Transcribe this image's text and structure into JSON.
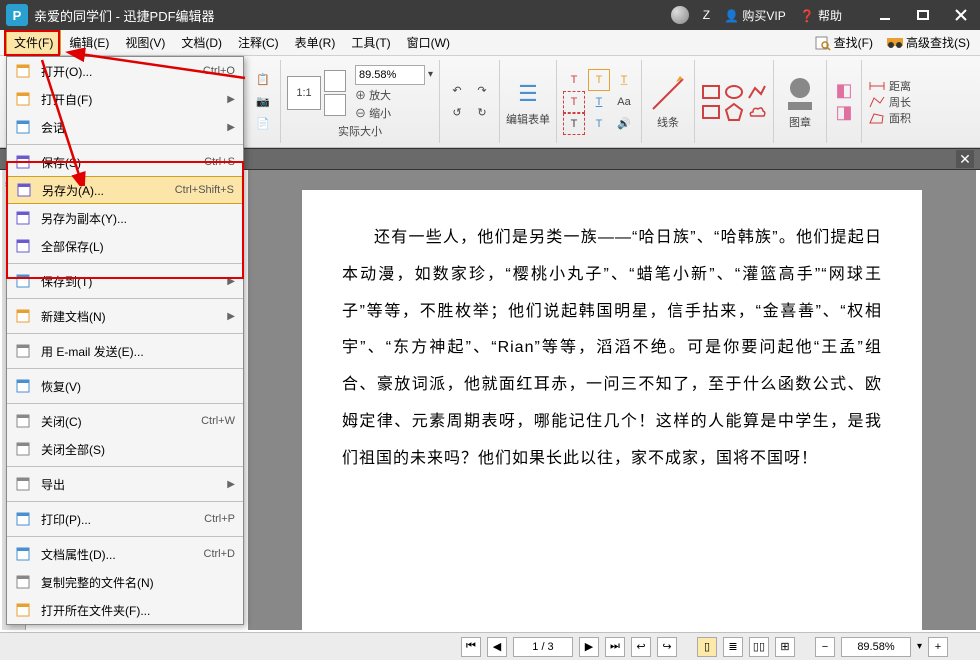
{
  "titlebar": {
    "app_icon_letter": "P",
    "title": "亲爱的同学们 - 迅捷PDF编辑器",
    "user_letter": "Z",
    "buy_vip": "购买VIP",
    "help": "帮助"
  },
  "menubar": {
    "items": [
      "文件(F)",
      "编辑(E)",
      "视图(V)",
      "文档(D)",
      "注释(C)",
      "表单(R)",
      "工具(T)",
      "窗口(W)"
    ],
    "find": "查找(F)",
    "advfind": "高级查找(S)"
  },
  "ribbon": {
    "real_size": "实际大小",
    "zoom_value": "89.58%",
    "zoom_in": "放大",
    "zoom_out": "缩小",
    "edit_form": "编辑表单",
    "lines": "线条",
    "stamp": "图章",
    "distance": "距离",
    "perimeter": "周长",
    "area": "面积"
  },
  "filemenu": {
    "items": [
      {
        "label": "打开(O)...",
        "shortcut": "Ctrl+O",
        "arrow": false,
        "sep": false,
        "color": "#e8a030"
      },
      {
        "label": "打开自(F)",
        "shortcut": "",
        "arrow": true,
        "sep": false,
        "color": "#e8a030"
      },
      {
        "label": "会话",
        "shortcut": "",
        "arrow": true,
        "sep": true,
        "color": "#4a90d0"
      },
      {
        "label": "保存(S)",
        "shortcut": "Ctrl+S",
        "arrow": false,
        "sep": false,
        "color": "#6a5acd"
      },
      {
        "label": "另存为(A)...",
        "shortcut": "Ctrl+Shift+S",
        "arrow": false,
        "sep": false,
        "selected": true,
        "color": "#6a5acd"
      },
      {
        "label": "另存为副本(Y)...",
        "shortcut": "",
        "arrow": false,
        "sep": false,
        "color": "#6a5acd"
      },
      {
        "label": "全部保存(L)",
        "shortcut": "",
        "arrow": false,
        "sep": true,
        "color": "#6a5acd"
      },
      {
        "label": "保存到(T)",
        "shortcut": "",
        "arrow": true,
        "sep": true,
        "color": "#4a90d0"
      },
      {
        "label": "新建文档(N)",
        "shortcut": "",
        "arrow": true,
        "sep": true,
        "color": "#e8a030"
      },
      {
        "label": "用 E-mail 发送(E)...",
        "shortcut": "",
        "arrow": false,
        "sep": true,
        "color": "#888"
      },
      {
        "label": "恢复(V)",
        "shortcut": "",
        "arrow": false,
        "sep": true,
        "color": "#4a90d0"
      },
      {
        "label": "关闭(C)",
        "shortcut": "Ctrl+W",
        "arrow": false,
        "sep": false,
        "color": "#888"
      },
      {
        "label": "关闭全部(S)",
        "shortcut": "",
        "arrow": false,
        "sep": true,
        "color": "#888"
      },
      {
        "label": "导出",
        "shortcut": "",
        "arrow": true,
        "sep": true,
        "color": "#888"
      },
      {
        "label": "打印(P)...",
        "shortcut": "Ctrl+P",
        "arrow": false,
        "sep": true,
        "color": "#4a90d0"
      },
      {
        "label": "文档属性(D)...",
        "shortcut": "Ctrl+D",
        "arrow": false,
        "sep": false,
        "color": "#4a90d0"
      },
      {
        "label": "复制完整的文件名(N)",
        "shortcut": "",
        "arrow": false,
        "sep": false,
        "color": "#888"
      },
      {
        "label": "打开所在文件夹(F)...",
        "shortcut": "",
        "arrow": false,
        "sep": false,
        "color": "#e8a030"
      }
    ]
  },
  "document": {
    "body": "还有一些人，他们是另类一族——“哈日族”、“哈韩族”。他们提起日本动漫，如数家珍，“樱桃小丸子”、“蜡笔小新”、“灌篮高手”“网球王子”等等，不胜枚举；他们说起韩国明星，信手拈来，“金喜善”、“权相宇”、“东方神起”、“Rian”等等，滔滔不绝。可是你要问起他“王孟”组合、豪放词派，他就面红耳赤，一问三不知了，至于什么函数公式、欧姆定律、元素周期表呀，哪能记住几个！这样的人能算是中学生，是我们祖国的未来吗？他们如果长此以往，家不成家，国将不国呀！"
  },
  "statusbar": {
    "page": "1 / 3",
    "zoom": "89.58%"
  }
}
